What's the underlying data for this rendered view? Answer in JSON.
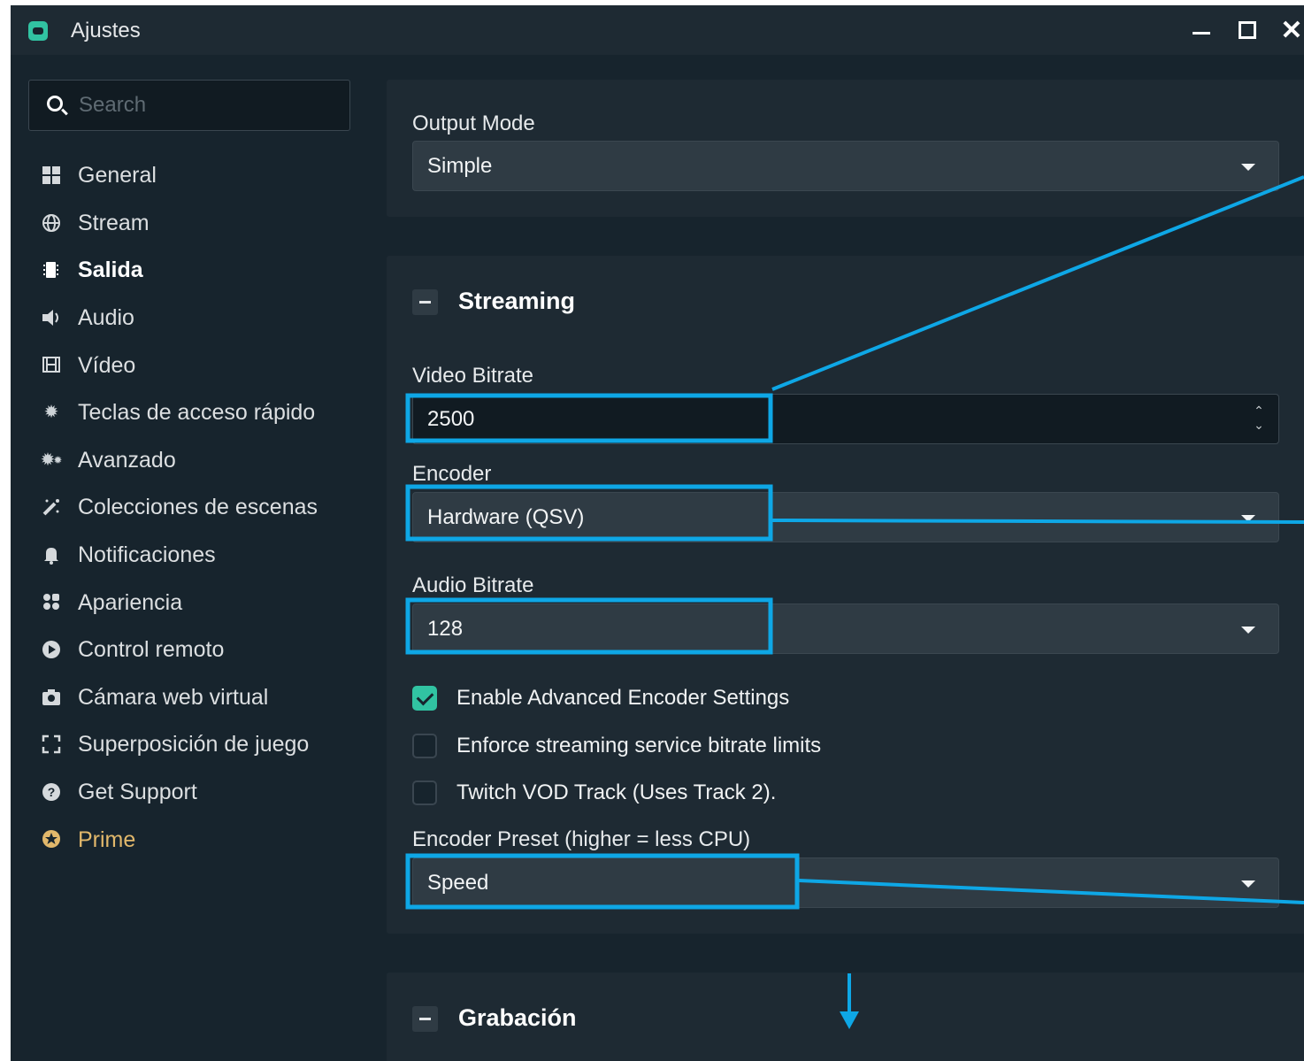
{
  "window": {
    "title": "Ajustes",
    "icons": {
      "app": "streamlabs-logo-icon",
      "minimize": "minimize-icon",
      "maximize": "maximize-icon",
      "close": "close-icon"
    }
  },
  "sidebar": {
    "search_placeholder": "Search",
    "items": [
      {
        "label": "General",
        "icon": "grid-icon"
      },
      {
        "label": "Stream",
        "icon": "globe-icon"
      },
      {
        "label": "Salida",
        "icon": "output-icon",
        "active": true
      },
      {
        "label": "Audio",
        "icon": "speaker-icon"
      },
      {
        "label": "Vídeo",
        "icon": "film-icon"
      },
      {
        "label": "Teclas de acceso rápido",
        "icon": "gear-icon"
      },
      {
        "label": "Avanzado",
        "icon": "gears-icon"
      },
      {
        "label": "Colecciones de escenas",
        "icon": "magic-icon"
      },
      {
        "label": "Notificaciones",
        "icon": "bell-icon"
      },
      {
        "label": "Apariencia",
        "icon": "palette-icon"
      },
      {
        "label": "Control remoto",
        "icon": "play-circle-icon"
      },
      {
        "label": "Cámara web virtual",
        "icon": "camera-icon"
      },
      {
        "label": "Superposición de juego",
        "icon": "expand-icon"
      },
      {
        "label": "Get Support",
        "icon": "help-icon"
      },
      {
        "label": "Prime",
        "icon": "prime-icon",
        "color": "#e2b86b"
      }
    ]
  },
  "output_mode": {
    "label": "Output Mode",
    "value": "Simple"
  },
  "streaming": {
    "title": "Streaming",
    "video_bitrate": {
      "label": "Video Bitrate",
      "value": "2500"
    },
    "encoder": {
      "label": "Encoder",
      "value": "Hardware (QSV)"
    },
    "audio_bitrate": {
      "label": "Audio Bitrate",
      "value": "128"
    },
    "checkboxes": [
      {
        "label": "Enable Advanced Encoder Settings",
        "checked": true
      },
      {
        "label": "Enforce streaming service bitrate limits",
        "checked": false
      },
      {
        "label": "Twitch VOD Track (Uses Track 2).",
        "checked": false
      }
    ],
    "encoder_preset": {
      "label": "Encoder Preset (higher = less CPU)",
      "value": "Speed"
    }
  },
  "recording": {
    "title": "Grabación"
  },
  "colors": {
    "accent": "#31c3a2",
    "annotation": "#0ea7e6",
    "background": "#17242d",
    "panel": "#1e2a33",
    "prime": "#e2b86b"
  }
}
